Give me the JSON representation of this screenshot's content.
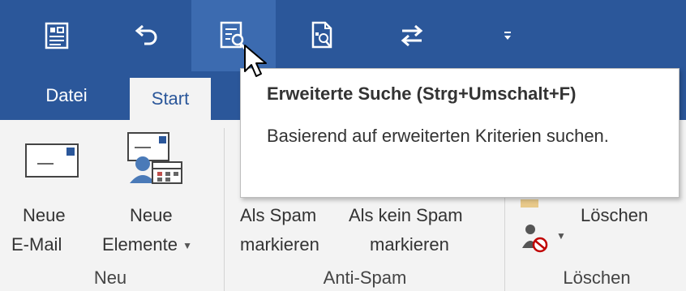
{
  "quick_access": {
    "buttons": [
      {
        "icon": "send-receive-icon"
      },
      {
        "icon": "undo-icon"
      },
      {
        "icon": "advanced-find-icon",
        "hovered": true
      },
      {
        "icon": "find-related-icon"
      },
      {
        "icon": "reply-forward-icon"
      },
      {
        "icon": "customize-dropdown-icon"
      }
    ]
  },
  "tabs": [
    {
      "label": "Datei",
      "active": false
    },
    {
      "label": "Start",
      "active": true
    }
  ],
  "ribbon": {
    "groups": {
      "neu": {
        "label": "Neu",
        "new_email": {
          "line1": "Neue",
          "line2": "E-Mail",
          "icon": "envelope-icon"
        },
        "new_items": {
          "line1": "Neue",
          "line2": "Elemente",
          "icon": "new-items-icon",
          "has_dropdown": true
        }
      },
      "anti_spam": {
        "label": "Anti-Spam",
        "mark_spam": {
          "line1": "Als Spam",
          "line2": "markieren"
        },
        "mark_not_spam": {
          "line1": "Als kein Spam",
          "line2": "markieren"
        }
      },
      "loeschen": {
        "label": "Löschen",
        "delete": {
          "label": "Löschen"
        },
        "block_sender": {
          "icon": "block-sender-icon",
          "has_dropdown": true
        }
      }
    }
  },
  "tooltip": {
    "title": "Erweiterte Suche (Strg+Umschalt+F)",
    "description": "Basierend auf erweiterten Kriterien suchen."
  },
  "colors": {
    "accent": "#2b579a",
    "hover": "#3c6bb0",
    "ribbon_bg": "#f3f3f3"
  }
}
